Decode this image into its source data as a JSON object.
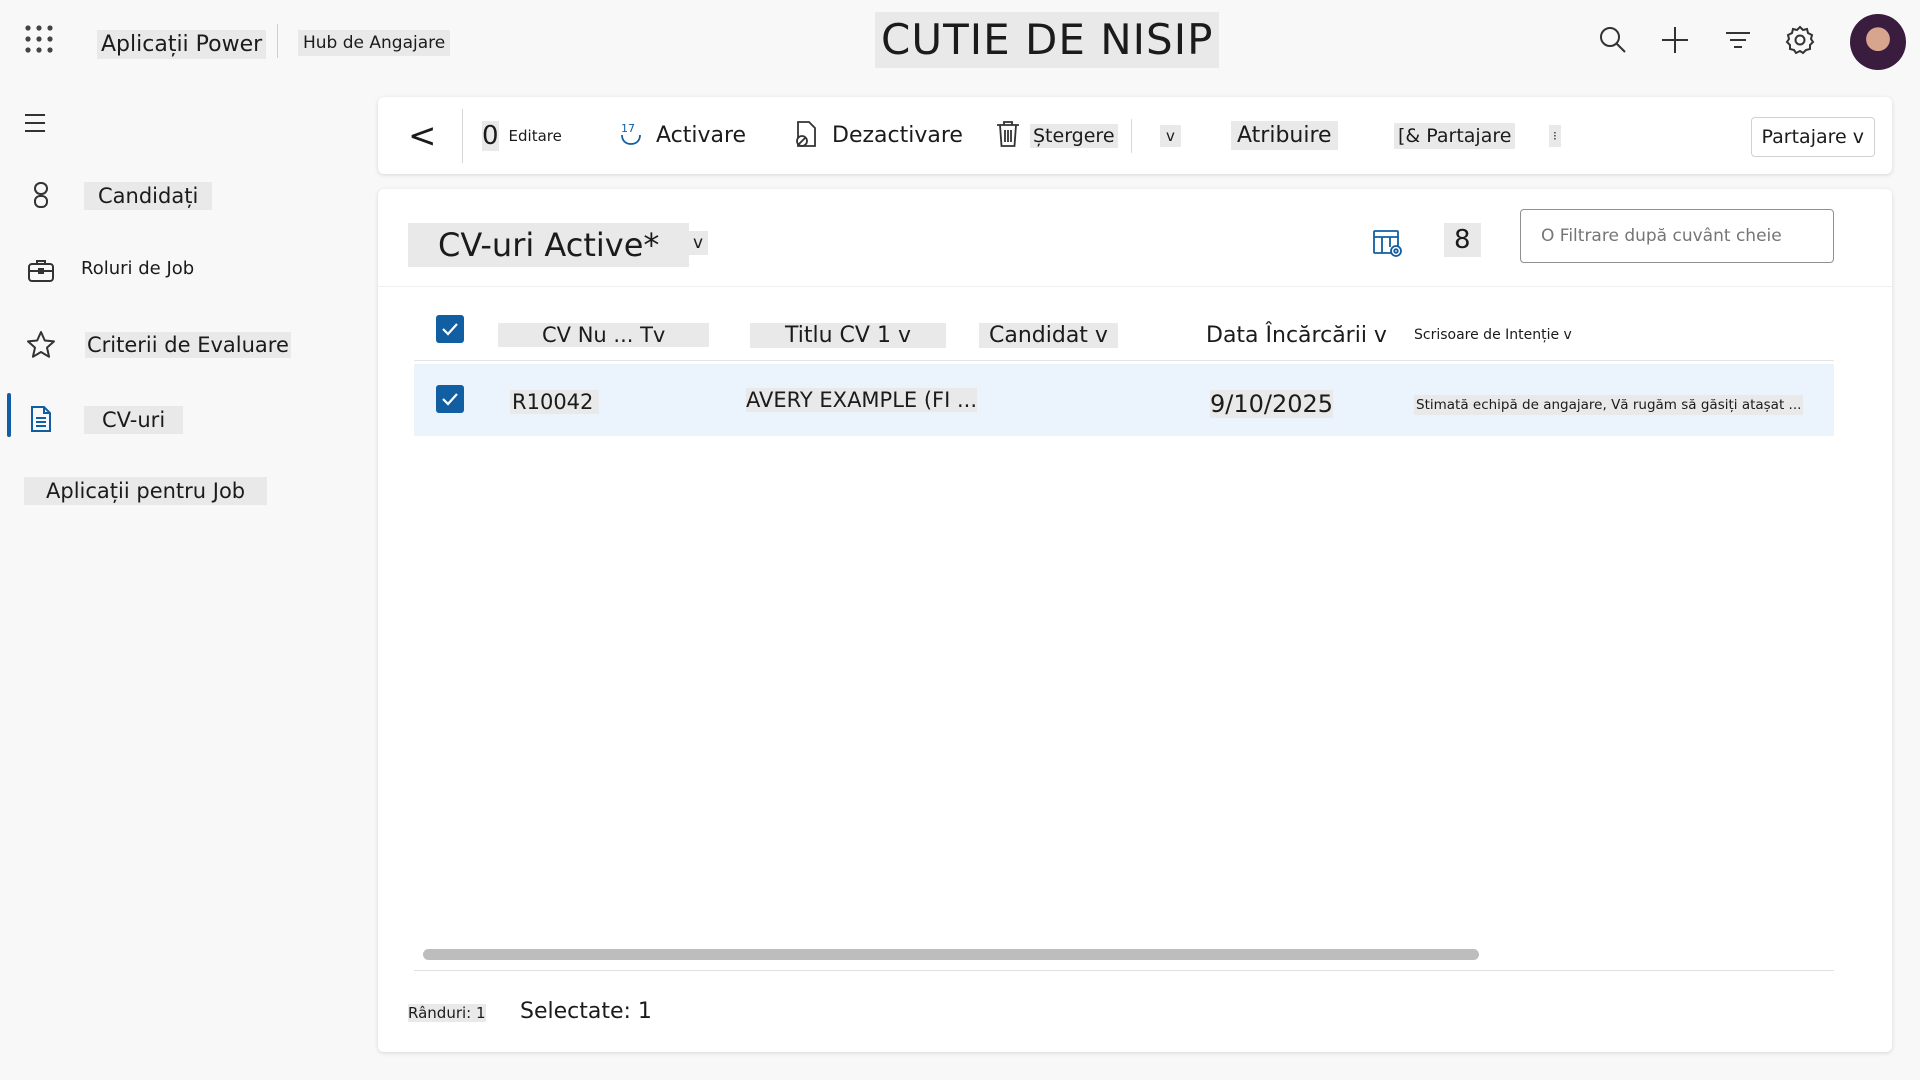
{
  "header": {
    "app_name": "Aplicații Power",
    "hub_name": "Hub de Angajare",
    "environment": "CUTIE DE NISIP",
    "icons": [
      "waffle-icon",
      "search-icon",
      "plus-icon",
      "filter-icon",
      "gear-icon"
    ]
  },
  "sidebar": {
    "items": [
      {
        "label": "Candidați",
        "icon": "person-icon"
      },
      {
        "label": "Roluri de Job",
        "icon": "briefcase-icon"
      },
      {
        "label": "Criterii de Evaluare",
        "icon": "star-icon"
      },
      {
        "label": "CV-uri",
        "icon": "document-icon",
        "active": true
      },
      {
        "label": "Aplicații pentru Job"
      }
    ]
  },
  "commandbar": {
    "back": "<",
    "edit_icon": "0",
    "edit": "Editare",
    "activate": "Activare",
    "deactivate": "Dezactivare",
    "delete": "Ștergere",
    "more": "v",
    "assign": "Atribuire",
    "share": "[& Partajare",
    "overflow": "⁝",
    "share_dropdown": "Partajare v"
  },
  "view": {
    "title": "CV-uri Active*",
    "chevron": "v",
    "count": "8",
    "filter_placeholder": "O Filtrare după cuvânt cheie"
  },
  "table": {
    "columns": [
      "CV Nu ... Tv",
      "Titlu CV 1 v",
      "Candidat v",
      "Data Încărcării v",
      "Scrisoare de Intenție v"
    ],
    "rows": [
      {
        "selected": true,
        "cv_nr": "R10042",
        "titlu": "AVERY EXAMPLE (FI ...",
        "candidat": "",
        "data": "9/10/2025",
        "scrisoare": "Stimată echipă de angajare, Vă rugăm să găsiți atașat ..."
      }
    ]
  },
  "footer": {
    "rows": "Rânduri: 1",
    "selected": "Selectate: 1"
  },
  "colors": {
    "accent": "#115ea3",
    "selected_row": "#ebf3fc"
  }
}
